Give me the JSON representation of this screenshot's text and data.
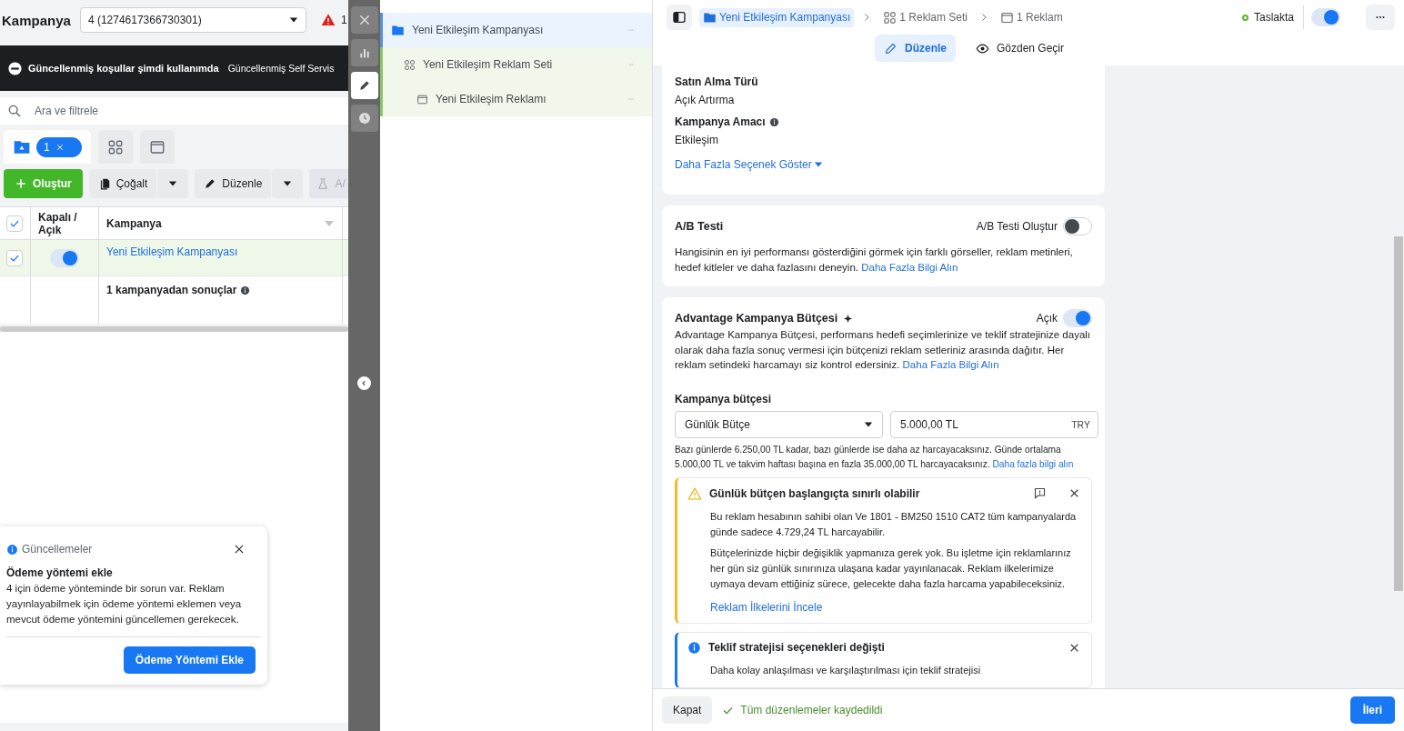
{
  "header": {
    "title": "Kampanya",
    "account_select": "4 (1274617366730301)",
    "warning_count": "1"
  },
  "banner": {
    "title": "Güncellenmiş koşullar şimdi kullanımda",
    "text": "Güncellenmiş Self Servis"
  },
  "search": {
    "placeholder": "Ara ve filtrele"
  },
  "level_tabs": [
    {
      "kind": "campaign",
      "badge": "1",
      "selected": true
    },
    {
      "kind": "adset",
      "selected": false
    },
    {
      "kind": "ad",
      "selected": false
    }
  ],
  "toolbar": [
    {
      "kind": "create",
      "label": "Oluştur"
    },
    {
      "kind": "duplicate",
      "label": "Çoğalt"
    },
    {
      "kind": "edit",
      "label": "Düzenle"
    },
    {
      "kind": "ab_test",
      "label": "A/"
    }
  ],
  "table": {
    "columns": [
      "Kapalı / Açık",
      "Kampanya"
    ],
    "all_checked": true,
    "rows": [
      {
        "checked": true,
        "on": true,
        "selected": true,
        "name": "Yeni Etkileşim Kampanyası"
      }
    ],
    "summary": "1 kampanyadan sonuçlar"
  },
  "notification": {
    "category": "Güncellemeler",
    "title": "Ödeme yöntemi ekle",
    "text": "4 için ödeme yönteminde bir sorun var. Reklam yayınlayabilmek için ödeme yöntemi eklemen veya mevcut ödeme yöntemini güncellemen gerekecek.",
    "button": "Ödeme Yöntemi Ekle"
  },
  "side_strip": [
    {
      "kind": "close",
      "selected": false
    },
    {
      "kind": "chart",
      "selected": false
    },
    {
      "kind": "edit",
      "selected": true
    },
    {
      "kind": "history",
      "selected": false
    }
  ],
  "tree": {
    "items": [
      {
        "kind": "campaign",
        "label": "Yeni Etkileşim Kampanyası",
        "selected": true,
        "children": [
          {
            "kind": "adset",
            "label": "Yeni Etkileşim Reklam Seti",
            "selected": false,
            "children": [
              {
                "kind": "ad",
                "label": "Yeni Etkileşim Reklamı",
                "selected": false
              }
            ]
          }
        ]
      }
    ]
  },
  "editor": {
    "breadcrumbs": [
      {
        "kind": "campaign",
        "label": "Yeni Etkileşim Kampanyası",
        "selected": true
      },
      {
        "kind": "adset",
        "label": "1 Reklam Seti",
        "selected": false
      },
      {
        "kind": "ad",
        "label": "1 Reklam",
        "selected": false
      }
    ],
    "status": "Taslakta",
    "on": true,
    "tabs": [
      {
        "kind": "edit",
        "label": "Düzenle",
        "selected": true
      },
      {
        "kind": "review",
        "label": "Gözden Geçir",
        "selected": false
      }
    ]
  },
  "sections": [
    {
      "kind": "fields",
      "fields": [
        {
          "label": "Satın Alma Türü",
          "info": false,
          "value": "Açık Artırma"
        },
        {
          "label": "Kampanya Amacı",
          "info": true,
          "value": "Etkileşim"
        }
      ],
      "link": "Daha Fazla Seçenek Göster"
    },
    {
      "kind": "toggle",
      "title": "A/B Testi",
      "toggle_label": "A/B Testi Oluştur",
      "on": false,
      "text": "Hangisinin en iyi performansı gösterdiğini görmek için farklı görseller, reklam metinleri, hedef kitleler ve daha fazlasını deneyin.",
      "link": "Daha Fazla Bilgi Alın"
    },
    {
      "kind": "budget",
      "title": "Advantage Kampanya Bütçesi",
      "toggle_label": "Açık",
      "on": true,
      "text": "Advantage Kampanya Bütçesi, performans hedefi seçimlerinize ve teklif stratejinize dayalı olarak daha fazla sonuç vermesi için bütçenizi reklam setleriniz arasında dağıtır. Her reklam setindeki harcamayı siz kontrol edersiniz.",
      "link": "Daha Fazla Bilgi Alın",
      "budget_label": "Kampanya bütçesi",
      "budget_type": "Günlük Bütçe",
      "amount": "5.000,00 TL",
      "currency": "TRY",
      "note": "Bazı günlerde 6.250,00 TL kadar, bazı günlerde ise daha az harcayacaksınız. Günde ortalama 5.000,00 TL ve takvim haftası başına en fazla 35.000,00 TL harcayacaksınız.",
      "note_link": "Daha fazla bilgi alın",
      "alerts": [
        {
          "kind": "warning",
          "title": "Günlük bütçen başlangıçta sınırlı olabilir",
          "paragraphs": [
            "Bu reklam hesabının sahibi olan Ve 1801 - BM250 1510 CAT2 tüm kampanyalarda günde sadece 4.729,24 TL harcayabilir.",
            "Bütçelerinizde hiçbir değişiklik yapmanıza gerek yok. Bu işletme için reklamlarınız her gün siz günlük sınırınıza ulaşana kadar yayınlanacak. Reklam ilkelerimize uymaya devam ettiğiniz sürece, gelecekte daha fazla harcama yapabileceksiniz."
          ],
          "link": "Reklam İlkelerini İncele"
        },
        {
          "kind": "info",
          "title": "Teklif stratejisi seçenekleri değişti",
          "paragraphs": [
            "Daha kolay anlaşılması ve karşılaştırılması için teklif stratejisi"
          ]
        }
      ]
    }
  ],
  "footer": {
    "close": "Kapat",
    "saved": "Tüm düzenlemeler kaydedildi",
    "next": "İleri"
  }
}
